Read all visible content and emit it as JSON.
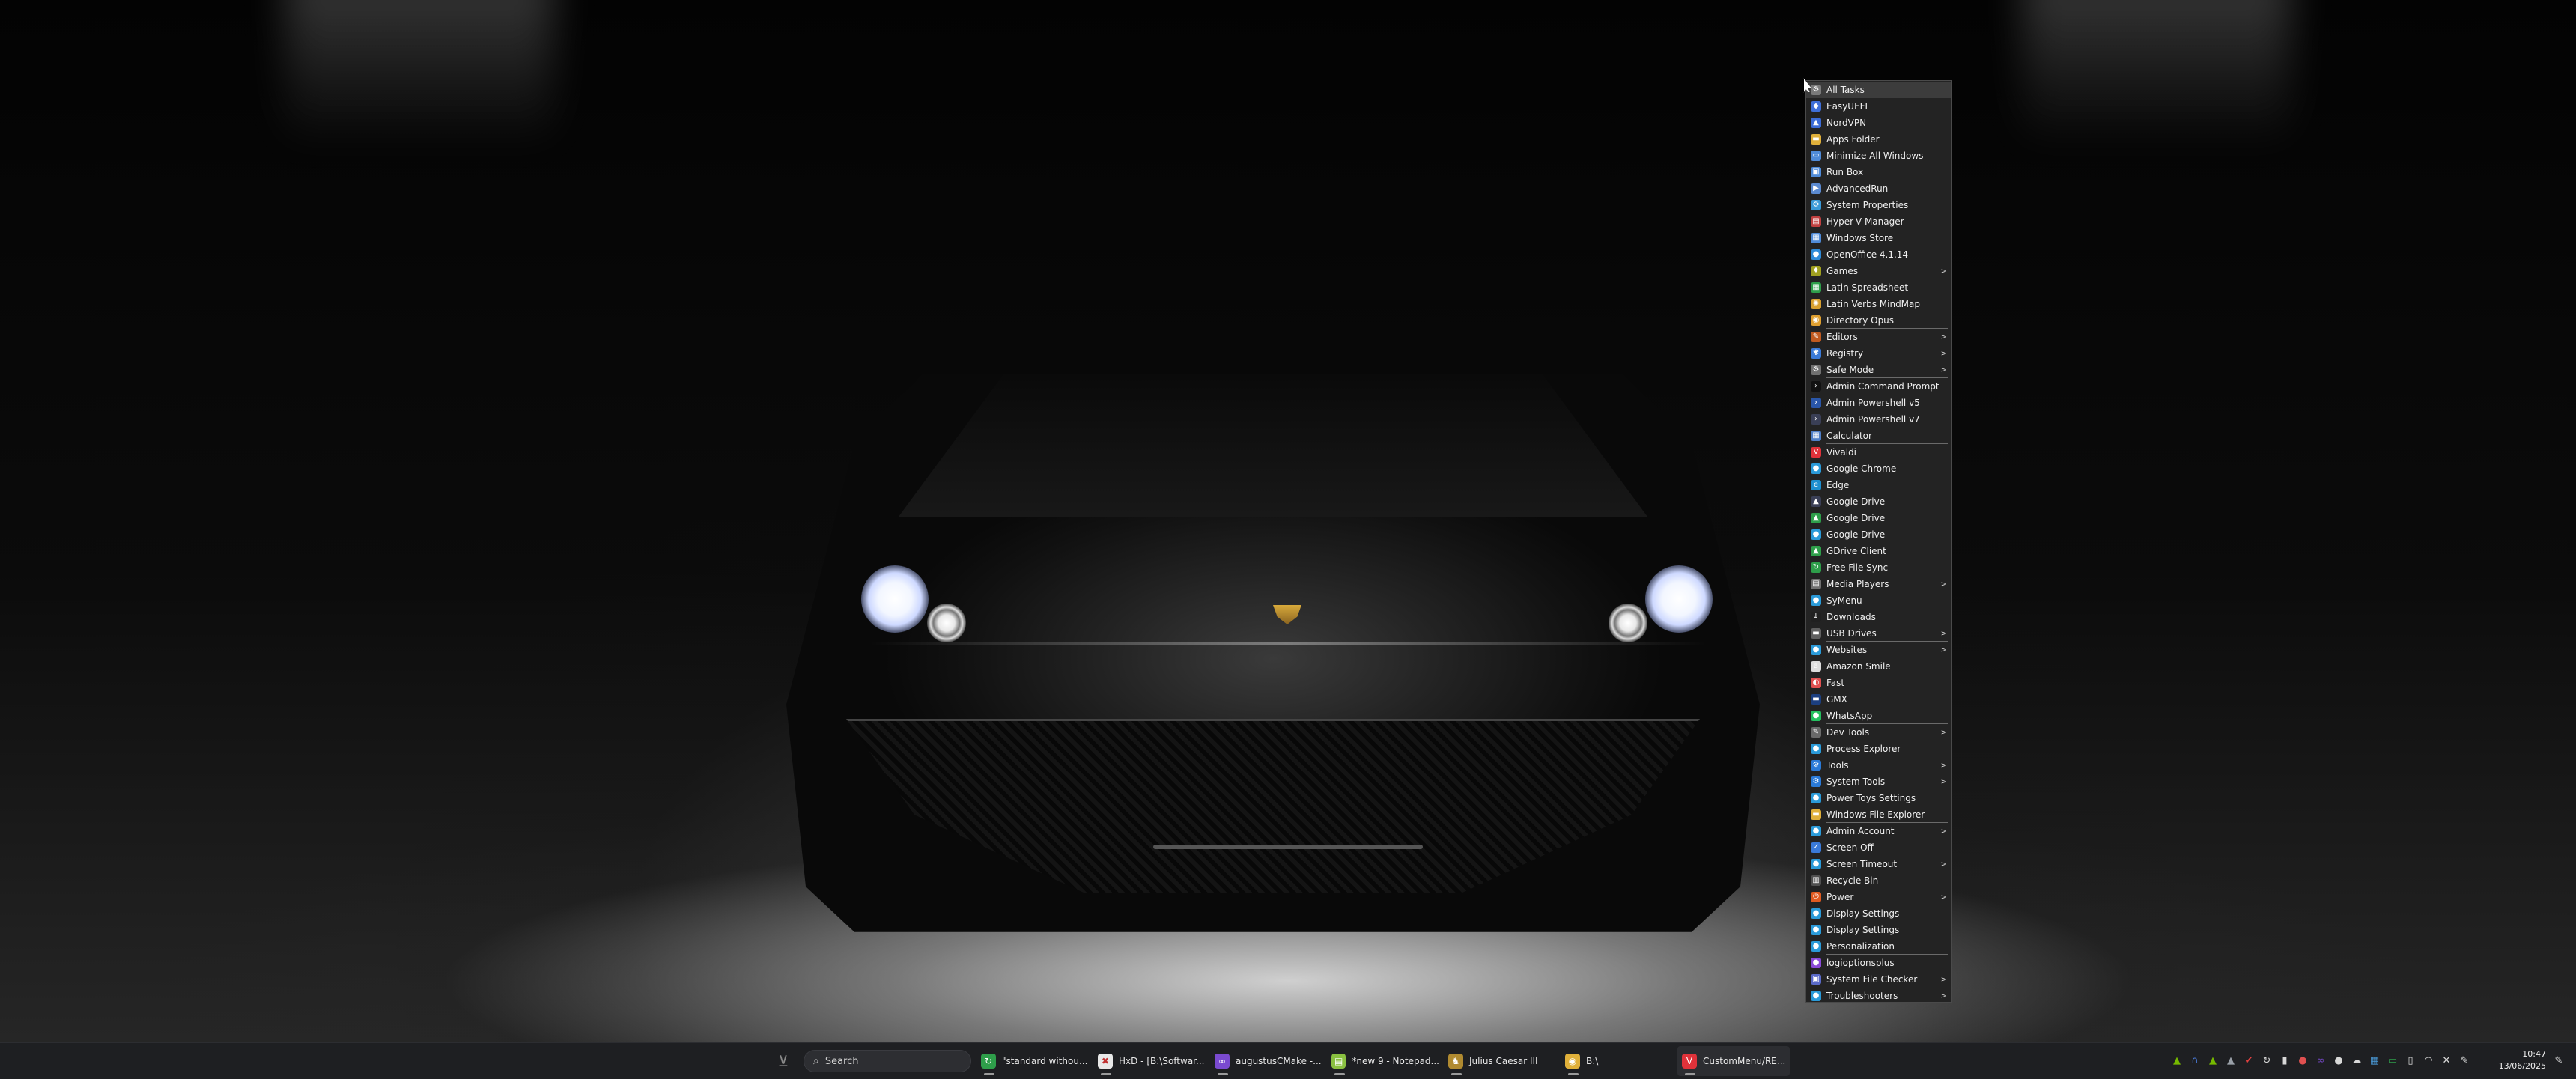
{
  "menu": {
    "items": [
      {
        "label": "All Tasks",
        "icon": "gear-icon",
        "color": "#7a7a7a",
        "glyph": "⚙",
        "submenu": false,
        "sep": false,
        "highlight": true
      },
      {
        "label": "EasyUEFI",
        "icon": "shield-icon",
        "color": "#3f6fd8",
        "glyph": "◆",
        "submenu": false,
        "sep": false
      },
      {
        "label": "NordVPN",
        "icon": "vpn-icon",
        "color": "#3b6bd6",
        "glyph": "▲",
        "submenu": false,
        "sep": false
      },
      {
        "label": "Apps Folder",
        "icon": "folder-icon",
        "color": "#e0b03a",
        "glyph": "▬",
        "submenu": false,
        "sep": false
      },
      {
        "label": "Minimize All Windows",
        "icon": "windows-icon",
        "color": "#4f8bd8",
        "glyph": "▭",
        "submenu": false,
        "sep": false
      },
      {
        "label": "Run Box",
        "icon": "run-icon",
        "color": "#4f8bd8",
        "glyph": "▣",
        "submenu": false,
        "sep": false
      },
      {
        "label": "AdvancedRun",
        "icon": "run-icon",
        "color": "#5b8ad0",
        "glyph": "▶",
        "submenu": false,
        "sep": false
      },
      {
        "label": "System Properties",
        "icon": "system-icon",
        "color": "#3a9ad8",
        "glyph": "⚙",
        "submenu": false,
        "sep": false
      },
      {
        "label": "Hyper-V Manager",
        "icon": "server-icon",
        "color": "#c04040",
        "glyph": "▤",
        "submenu": false,
        "sep": false
      },
      {
        "label": "Windows Store",
        "icon": "store-icon",
        "color": "#4f8bd8",
        "glyph": "▦",
        "submenu": false,
        "sep": true
      },
      {
        "label": "OpenOffice 4.1.14",
        "icon": "office-icon",
        "color": "#2e8bd8",
        "glyph": "●",
        "submenu": false,
        "sep": false
      },
      {
        "label": "Games",
        "icon": "games-icon",
        "color": "#a0a020",
        "glyph": "♦",
        "submenu": true,
        "sep": false
      },
      {
        "label": "Latin Spreadsheet",
        "icon": "spreadsheet-icon",
        "color": "#2e9e4a",
        "glyph": "▦",
        "submenu": false,
        "sep": false
      },
      {
        "label": "Latin Verbs MindMap",
        "icon": "mindmap-icon",
        "color": "#d8a030",
        "glyph": "✺",
        "submenu": false,
        "sep": false
      },
      {
        "label": "Directory Opus",
        "icon": "opus-icon",
        "color": "#e0a030",
        "glyph": "◉",
        "submenu": false,
        "sep": true
      },
      {
        "label": "Editors",
        "icon": "editor-icon",
        "color": "#c05a20",
        "glyph": "✎",
        "submenu": true,
        "sep": false
      },
      {
        "label": "Registry",
        "icon": "registry-icon",
        "color": "#3a7ad8",
        "glyph": "✱",
        "submenu": true,
        "sep": false
      },
      {
        "label": "Safe Mode",
        "icon": "gear-icon",
        "color": "#707070",
        "glyph": "⚙",
        "submenu": true,
        "sep": true
      },
      {
        "label": "Admin Command Prompt",
        "icon": "terminal-icon",
        "color": "#111111",
        "glyph": "›",
        "submenu": false,
        "sep": false
      },
      {
        "label": "Admin Powershell v5",
        "icon": "powershell-icon",
        "color": "#2a56a8",
        "glyph": "›",
        "submenu": false,
        "sep": false
      },
      {
        "label": "Admin Powershell v7",
        "icon": "powershell-icon",
        "color": "#3a3f56",
        "glyph": "›",
        "submenu": false,
        "sep": false
      },
      {
        "label": "Calculator",
        "icon": "calculator-icon",
        "color": "#4f7fc8",
        "glyph": "▦",
        "submenu": false,
        "sep": true
      },
      {
        "label": "Vivaldi",
        "icon": "vivaldi-icon",
        "color": "#e0323a",
        "glyph": "V",
        "submenu": false,
        "sep": false
      },
      {
        "label": "Google Chrome",
        "icon": "chrome-icon",
        "color": "#2a9ad8",
        "glyph": "●",
        "submenu": false,
        "sep": false
      },
      {
        "label": "Edge",
        "icon": "edge-icon",
        "color": "#1d8fd0",
        "glyph": "e",
        "submenu": false,
        "sep": true
      },
      {
        "label": "Google Drive",
        "icon": "drive-icon",
        "color": "#3a3f56",
        "glyph": "▲",
        "submenu": false,
        "sep": false
      },
      {
        "label": "Google Drive",
        "icon": "drive-icon",
        "color": "#2e9e4a",
        "glyph": "▲",
        "submenu": false,
        "sep": false
      },
      {
        "label": "Google Drive",
        "icon": "drive-icon",
        "color": "#2a9ad8",
        "glyph": "●",
        "submenu": false,
        "sep": false
      },
      {
        "label": "GDrive Client",
        "icon": "drive-icon",
        "color": "#2e9e4a",
        "glyph": "▲",
        "submenu": false,
        "sep": true
      },
      {
        "label": "Free File Sync",
        "icon": "sync-icon",
        "color": "#2e9e4a",
        "glyph": "↻",
        "submenu": false,
        "sep": false
      },
      {
        "label": "Media Players",
        "icon": "media-icon",
        "color": "#707070",
        "glyph": "▤",
        "submenu": true,
        "sep": true
      },
      {
        "label": "SyMenu",
        "icon": "symenu-icon",
        "color": "#2a9ad8",
        "glyph": "●",
        "submenu": false,
        "sep": false
      },
      {
        "label": "Downloads",
        "icon": "download-icon",
        "color": "#202020",
        "glyph": "↓",
        "submenu": false,
        "sep": false
      },
      {
        "label": "USB Drives",
        "icon": "usb-icon",
        "color": "#606060",
        "glyph": "▬",
        "submenu": true,
        "sep": true
      },
      {
        "label": "Websites",
        "icon": "globe-icon",
        "color": "#2a9ad8",
        "glyph": "●",
        "submenu": true,
        "sep": false
      },
      {
        "label": "Amazon Smile",
        "icon": "amazon-icon",
        "color": "#dddddd",
        "glyph": "a",
        "submenu": false,
        "sep": false
      },
      {
        "label": "Fast",
        "icon": "speed-icon",
        "color": "#e05050",
        "glyph": "◐",
        "submenu": false,
        "sep": false
      },
      {
        "label": "GMX",
        "icon": "mail-icon",
        "color": "#1c3f80",
        "glyph": "▬",
        "submenu": false,
        "sep": false
      },
      {
        "label": "WhatsApp",
        "icon": "whatsapp-icon",
        "color": "#25c060",
        "glyph": "●",
        "submenu": false,
        "sep": true
      },
      {
        "label": "Dev Tools",
        "icon": "devtools-icon",
        "color": "#6a6a6a",
        "glyph": "✎",
        "submenu": true,
        "sep": false
      },
      {
        "label": "Process Explorer",
        "icon": "process-icon",
        "color": "#2a9ad8",
        "glyph": "●",
        "submenu": false,
        "sep": false
      },
      {
        "label": "Tools",
        "icon": "tools-icon",
        "color": "#2a7ad8",
        "glyph": "⚙",
        "submenu": true,
        "sep": false
      },
      {
        "label": "System Tools",
        "icon": "system-tools-icon",
        "color": "#2a7ad8",
        "glyph": "⚙",
        "submenu": true,
        "sep": false
      },
      {
        "label": "Power Toys Settings",
        "icon": "powertoys-icon",
        "color": "#2a9ad8",
        "glyph": "●",
        "submenu": false,
        "sep": false
      },
      {
        "label": "Windows File Explorer",
        "icon": "folder-icon",
        "color": "#e0b03a",
        "glyph": "▬",
        "submenu": false,
        "sep": true
      },
      {
        "label": "Admin Account",
        "icon": "admin-icon",
        "color": "#2a9ad8",
        "glyph": "●",
        "submenu": true,
        "sep": false
      },
      {
        "label": "Screen Off",
        "icon": "screen-off-icon",
        "color": "#3a7ad8",
        "glyph": "✓",
        "submenu": false,
        "sep": false
      },
      {
        "label": "Screen Timeout",
        "icon": "timer-icon",
        "color": "#2a9ad8",
        "glyph": "●",
        "submenu": true,
        "sep": false
      },
      {
        "label": "Recycle Bin",
        "icon": "recycle-bin-icon",
        "color": "#505050",
        "glyph": "▥",
        "submenu": false,
        "sep": false
      },
      {
        "label": "Power",
        "icon": "power-icon",
        "color": "#e05a20",
        "glyph": "⏻",
        "submenu": true,
        "sep": true
      },
      {
        "label": "Display Settings",
        "icon": "display-icon",
        "color": "#2a9ad8",
        "glyph": "●",
        "submenu": false,
        "sep": false
      },
      {
        "label": "Display Settings",
        "icon": "display-icon",
        "color": "#2a9ad8",
        "glyph": "●",
        "submenu": false,
        "sep": false
      },
      {
        "label": "Personalization",
        "icon": "personalization-icon",
        "color": "#2a9ad8",
        "glyph": "●",
        "submenu": false,
        "sep": true
      },
      {
        "label": "logioptionsplus",
        "icon": "logitech-icon",
        "color": "#8a4ad8",
        "glyph": "●",
        "submenu": false,
        "sep": false
      },
      {
        "label": "System File Checker",
        "icon": "checker-icon",
        "color": "#5a6ac8",
        "glyph": "▣",
        "submenu": true,
        "sep": false
      },
      {
        "label": "Troubleshooters",
        "icon": "troubleshoot-icon",
        "color": "#2a9ad8",
        "glyph": "●",
        "submenu": true,
        "sep": false
      }
    ]
  },
  "taskbar": {
    "search_label": "Search",
    "apps": [
      {
        "label": "\"standard withou...",
        "icon": "sync-icon",
        "color": "#2e9e4a",
        "glyph": "↻",
        "active": false
      },
      {
        "label": "HxD - [B:\\Softwar...",
        "icon": "hex-editor-icon",
        "color": "#e8e8e8",
        "glyph": "✖",
        "active": false
      },
      {
        "label": "augustusCMake -...",
        "icon": "visual-studio-icon",
        "color": "#7a4ad0",
        "glyph": "∞",
        "active": false
      },
      {
        "label": "*new 9 - Notepad...",
        "icon": "notepad-icon",
        "color": "#8ac040",
        "glyph": "▤",
        "active": false
      },
      {
        "label": "Julius Caesar III",
        "icon": "game-icon",
        "color": "#b08a30",
        "glyph": "♞",
        "active": false
      },
      {
        "label": "B:\\",
        "icon": "folder-icon",
        "color": "#e0b03a",
        "glyph": "◉",
        "active": false
      },
      {
        "label": "CustomMenu/RE...",
        "icon": "vivaldi-icon",
        "color": "#e0323a",
        "glyph": "V",
        "active": true
      }
    ],
    "tray": [
      {
        "icon": "nvidia-icon",
        "glyph": "▲",
        "color": "#76b900"
      },
      {
        "icon": "nordvpn-tray-icon",
        "glyph": "∩",
        "color": "#4a7ad8"
      },
      {
        "icon": "gpu-tray-icon",
        "glyph": "▲",
        "color": "#76b900"
      },
      {
        "icon": "drive-tray-icon",
        "glyph": "▲",
        "color": "#9aa0a8"
      },
      {
        "icon": "shield-tray-icon",
        "glyph": "✔",
        "color": "#e04040"
      },
      {
        "icon": "sync-tray-icon",
        "glyph": "↻",
        "color": "#d8d8d8"
      },
      {
        "icon": "usb-tray-icon",
        "glyph": "▮",
        "color": "#d8d8d8"
      },
      {
        "icon": "network-tray-icon",
        "glyph": "●",
        "color": "#e05050"
      },
      {
        "icon": "vs-tray-icon",
        "glyph": "∞",
        "color": "#7a4ad0"
      },
      {
        "icon": "chat-tray-icon",
        "glyph": "●",
        "color": "#d8d8d8"
      },
      {
        "icon": "onedrive-tray-icon",
        "glyph": "☁",
        "color": "#d8d8d8"
      },
      {
        "icon": "display-tray-icon",
        "glyph": "▦",
        "color": "#4a9ad8"
      },
      {
        "icon": "monitor-tray-icon",
        "glyph": "▭",
        "color": "#2e9e4a"
      },
      {
        "icon": "battery-tray-icon",
        "glyph": "▯",
        "color": "#d8d8d8"
      },
      {
        "icon": "wifi-icon",
        "glyph": "◠",
        "color": "#d8d8d8"
      },
      {
        "icon": "speaker-muted-icon",
        "glyph": "✕",
        "color": "#d8d8d8"
      },
      {
        "icon": "pen-tray-icon",
        "glyph": "✎",
        "color": "#d8d8d8"
      }
    ],
    "clock_time": "10:47",
    "clock_date": "13/06/2025"
  }
}
